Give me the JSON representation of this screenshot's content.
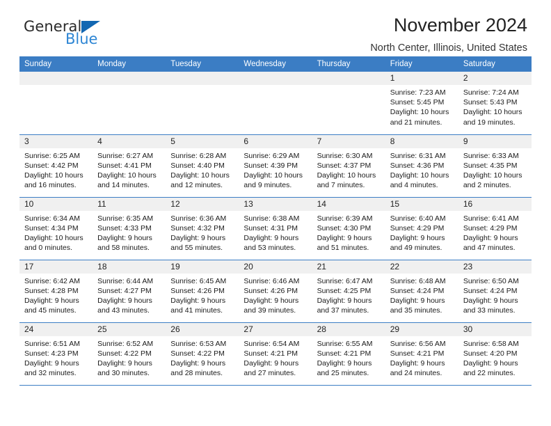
{
  "brand": {
    "word1": "General",
    "word2": "Blue",
    "triangle_color": "#1267b2",
    "blue_text_color": "#2e86d4"
  },
  "header": {
    "title": "November 2024",
    "location": "North Center, Illinois, United States"
  },
  "theme": {
    "header_blue": "#3b7dc4",
    "daynum_band": "#f0f0f0",
    "page_background": "#ffffff"
  },
  "calendar": {
    "weekday_headers": [
      "Sunday",
      "Monday",
      "Tuesday",
      "Wednesday",
      "Thursday",
      "Friday",
      "Saturday"
    ],
    "weeks": [
      [
        {
          "empty": true
        },
        {
          "empty": true
        },
        {
          "empty": true
        },
        {
          "empty": true
        },
        {
          "empty": true
        },
        {
          "day": "1",
          "sunrise": "Sunrise: 7:23 AM",
          "sunset": "Sunset: 5:45 PM",
          "daylight1": "Daylight: 10 hours",
          "daylight2": "and 21 minutes."
        },
        {
          "day": "2",
          "sunrise": "Sunrise: 7:24 AM",
          "sunset": "Sunset: 5:43 PM",
          "daylight1": "Daylight: 10 hours",
          "daylight2": "and 19 minutes."
        }
      ],
      [
        {
          "day": "3",
          "sunrise": "Sunrise: 6:25 AM",
          "sunset": "Sunset: 4:42 PM",
          "daylight1": "Daylight: 10 hours",
          "daylight2": "and 16 minutes."
        },
        {
          "day": "4",
          "sunrise": "Sunrise: 6:27 AM",
          "sunset": "Sunset: 4:41 PM",
          "daylight1": "Daylight: 10 hours",
          "daylight2": "and 14 minutes."
        },
        {
          "day": "5",
          "sunrise": "Sunrise: 6:28 AM",
          "sunset": "Sunset: 4:40 PM",
          "daylight1": "Daylight: 10 hours",
          "daylight2": "and 12 minutes."
        },
        {
          "day": "6",
          "sunrise": "Sunrise: 6:29 AM",
          "sunset": "Sunset: 4:39 PM",
          "daylight1": "Daylight: 10 hours",
          "daylight2": "and 9 minutes."
        },
        {
          "day": "7",
          "sunrise": "Sunrise: 6:30 AM",
          "sunset": "Sunset: 4:37 PM",
          "daylight1": "Daylight: 10 hours",
          "daylight2": "and 7 minutes."
        },
        {
          "day": "8",
          "sunrise": "Sunrise: 6:31 AM",
          "sunset": "Sunset: 4:36 PM",
          "daylight1": "Daylight: 10 hours",
          "daylight2": "and 4 minutes."
        },
        {
          "day": "9",
          "sunrise": "Sunrise: 6:33 AM",
          "sunset": "Sunset: 4:35 PM",
          "daylight1": "Daylight: 10 hours",
          "daylight2": "and 2 minutes."
        }
      ],
      [
        {
          "day": "10",
          "sunrise": "Sunrise: 6:34 AM",
          "sunset": "Sunset: 4:34 PM",
          "daylight1": "Daylight: 10 hours",
          "daylight2": "and 0 minutes."
        },
        {
          "day": "11",
          "sunrise": "Sunrise: 6:35 AM",
          "sunset": "Sunset: 4:33 PM",
          "daylight1": "Daylight: 9 hours",
          "daylight2": "and 58 minutes."
        },
        {
          "day": "12",
          "sunrise": "Sunrise: 6:36 AM",
          "sunset": "Sunset: 4:32 PM",
          "daylight1": "Daylight: 9 hours",
          "daylight2": "and 55 minutes."
        },
        {
          "day": "13",
          "sunrise": "Sunrise: 6:38 AM",
          "sunset": "Sunset: 4:31 PM",
          "daylight1": "Daylight: 9 hours",
          "daylight2": "and 53 minutes."
        },
        {
          "day": "14",
          "sunrise": "Sunrise: 6:39 AM",
          "sunset": "Sunset: 4:30 PM",
          "daylight1": "Daylight: 9 hours",
          "daylight2": "and 51 minutes."
        },
        {
          "day": "15",
          "sunrise": "Sunrise: 6:40 AM",
          "sunset": "Sunset: 4:29 PM",
          "daylight1": "Daylight: 9 hours",
          "daylight2": "and 49 minutes."
        },
        {
          "day": "16",
          "sunrise": "Sunrise: 6:41 AM",
          "sunset": "Sunset: 4:29 PM",
          "daylight1": "Daylight: 9 hours",
          "daylight2": "and 47 minutes."
        }
      ],
      [
        {
          "day": "17",
          "sunrise": "Sunrise: 6:42 AM",
          "sunset": "Sunset: 4:28 PM",
          "daylight1": "Daylight: 9 hours",
          "daylight2": "and 45 minutes."
        },
        {
          "day": "18",
          "sunrise": "Sunrise: 6:44 AM",
          "sunset": "Sunset: 4:27 PM",
          "daylight1": "Daylight: 9 hours",
          "daylight2": "and 43 minutes."
        },
        {
          "day": "19",
          "sunrise": "Sunrise: 6:45 AM",
          "sunset": "Sunset: 4:26 PM",
          "daylight1": "Daylight: 9 hours",
          "daylight2": "and 41 minutes."
        },
        {
          "day": "20",
          "sunrise": "Sunrise: 6:46 AM",
          "sunset": "Sunset: 4:26 PM",
          "daylight1": "Daylight: 9 hours",
          "daylight2": "and 39 minutes."
        },
        {
          "day": "21",
          "sunrise": "Sunrise: 6:47 AM",
          "sunset": "Sunset: 4:25 PM",
          "daylight1": "Daylight: 9 hours",
          "daylight2": "and 37 minutes."
        },
        {
          "day": "22",
          "sunrise": "Sunrise: 6:48 AM",
          "sunset": "Sunset: 4:24 PM",
          "daylight1": "Daylight: 9 hours",
          "daylight2": "and 35 minutes."
        },
        {
          "day": "23",
          "sunrise": "Sunrise: 6:50 AM",
          "sunset": "Sunset: 4:24 PM",
          "daylight1": "Daylight: 9 hours",
          "daylight2": "and 33 minutes."
        }
      ],
      [
        {
          "day": "24",
          "sunrise": "Sunrise: 6:51 AM",
          "sunset": "Sunset: 4:23 PM",
          "daylight1": "Daylight: 9 hours",
          "daylight2": "and 32 minutes."
        },
        {
          "day": "25",
          "sunrise": "Sunrise: 6:52 AM",
          "sunset": "Sunset: 4:22 PM",
          "daylight1": "Daylight: 9 hours",
          "daylight2": "and 30 minutes."
        },
        {
          "day": "26",
          "sunrise": "Sunrise: 6:53 AM",
          "sunset": "Sunset: 4:22 PM",
          "daylight1": "Daylight: 9 hours",
          "daylight2": "and 28 minutes."
        },
        {
          "day": "27",
          "sunrise": "Sunrise: 6:54 AM",
          "sunset": "Sunset: 4:21 PM",
          "daylight1": "Daylight: 9 hours",
          "daylight2": "and 27 minutes."
        },
        {
          "day": "28",
          "sunrise": "Sunrise: 6:55 AM",
          "sunset": "Sunset: 4:21 PM",
          "daylight1": "Daylight: 9 hours",
          "daylight2": "and 25 minutes."
        },
        {
          "day": "29",
          "sunrise": "Sunrise: 6:56 AM",
          "sunset": "Sunset: 4:21 PM",
          "daylight1": "Daylight: 9 hours",
          "daylight2": "and 24 minutes."
        },
        {
          "day": "30",
          "sunrise": "Sunrise: 6:58 AM",
          "sunset": "Sunset: 4:20 PM",
          "daylight1": "Daylight: 9 hours",
          "daylight2": "and 22 minutes."
        }
      ]
    ]
  }
}
